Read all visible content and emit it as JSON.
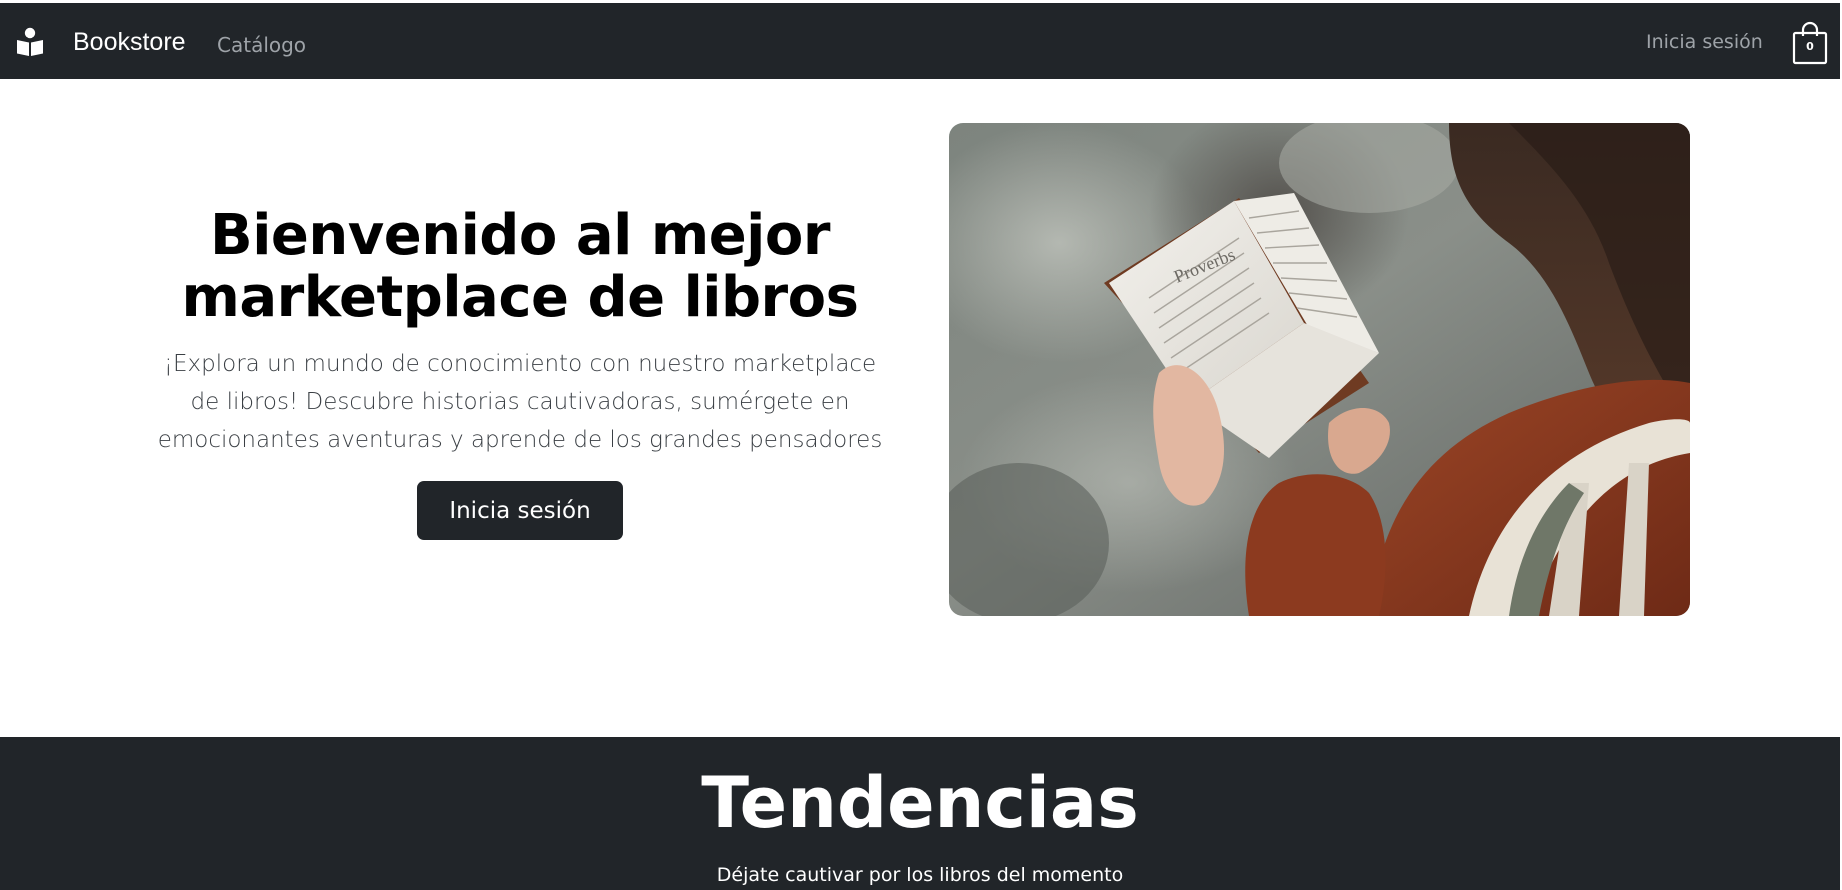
{
  "navbar": {
    "brand_icon": "reader-icon",
    "brand": "Bookstore",
    "catalog_link": "Catálogo",
    "login_link": "Inicia sesión",
    "cart_icon": "shopping-bag-icon",
    "cart_count": "0"
  },
  "hero": {
    "title": "Bienvenido al mejor marketplace de libros",
    "text": "¡Explora un mundo de conocimiento con nuestro marketplace de libros! Descubre historias cautivadoras, sumérgete en emocionantes aventuras y aprende de los grandes pensadores",
    "button": "Inicia sesión",
    "image_alt": "Mujer leyendo un libro (Proverbs)"
  },
  "trends": {
    "title": "Tendencias",
    "subtitle": "Déjate cautivar por los libros del momento"
  },
  "colors": {
    "dark": "#212529",
    "nav_text": "#9ea3a8",
    "white": "#ffffff"
  }
}
